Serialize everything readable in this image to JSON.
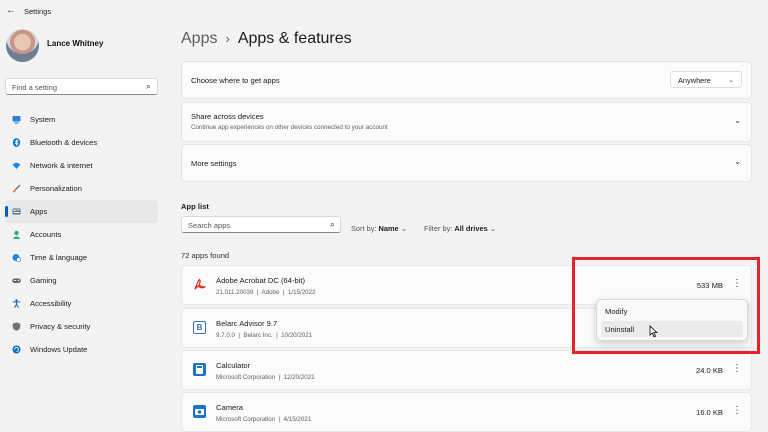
{
  "window": {
    "title": "Settings"
  },
  "profile": {
    "name": "Lance Whitney"
  },
  "sidebar": {
    "search_placeholder": "Find a setting",
    "items": [
      {
        "label": "System",
        "icon": "monitor-icon",
        "color": "#2f7fd6"
      },
      {
        "label": "Bluetooth & devices",
        "icon": "bluetooth-icon",
        "color": "#0078d4"
      },
      {
        "label": "Network & internet",
        "icon": "wifi-icon",
        "color": "#1e88e5"
      },
      {
        "label": "Personalization",
        "icon": "brush-icon",
        "color": "#e07b39"
      },
      {
        "label": "Apps",
        "icon": "apps-icon",
        "color": "#5a6f8c",
        "active": true
      },
      {
        "label": "Accounts",
        "icon": "person-icon",
        "color": "#2aa876"
      },
      {
        "label": "Time & language",
        "icon": "globe-clock-icon",
        "color": "#1e88e5"
      },
      {
        "label": "Gaming",
        "icon": "gamepad-icon",
        "color": "#666666"
      },
      {
        "label": "Accessibility",
        "icon": "accessibility-icon",
        "color": "#1565c0"
      },
      {
        "label": "Privacy & security",
        "icon": "shield-icon",
        "color": "#6b7580"
      },
      {
        "label": "Windows Update",
        "icon": "update-icon",
        "color": "#0b6fc6"
      }
    ]
  },
  "breadcrumb": {
    "parent": "Apps",
    "separator": "›",
    "current": "Apps & features"
  },
  "settings_cards": {
    "where": {
      "title": "Choose where to get apps",
      "dropdown_value": "Anywhere"
    },
    "share": {
      "title": "Share across devices",
      "subtitle": "Continue app experiences on other devices connected to your account"
    },
    "more": {
      "title": "More settings"
    }
  },
  "app_list": {
    "heading": "App list",
    "search_placeholder": "Search apps",
    "sort_label": "Sort by:",
    "sort_value": "Name",
    "filter_label": "Filter by:",
    "filter_value": "All drives",
    "count_text": "72 apps found",
    "apps": [
      {
        "name": "Adobe Acrobat DC (64-bit)",
        "version": "21.011.20039",
        "publisher": "Adobe",
        "date": "1/15/2022",
        "size": "533 MB",
        "icon": "acrobat-icon"
      },
      {
        "name": "Belarc Advisor 9.7",
        "version": "9.7.0.0",
        "publisher": "Belarc Inc.",
        "date": "10/20/2021",
        "size": "",
        "icon": "belarc-icon"
      },
      {
        "name": "Calculator",
        "version": "",
        "publisher": "Microsoft Corporation",
        "date": "12/20/2021",
        "size": "24.0 KB",
        "icon": "calculator-icon"
      },
      {
        "name": "Camera",
        "version": "",
        "publisher": "Microsoft Corporation",
        "date": "4/15/2021",
        "size": "16.0 KB",
        "icon": "camera-icon"
      }
    ]
  },
  "context_menu": {
    "items": [
      "Modify",
      "Uninstall"
    ],
    "hovered": "Uninstall"
  },
  "colors": {
    "accent": "#005fb8",
    "highlight_box": "#e3242b"
  }
}
